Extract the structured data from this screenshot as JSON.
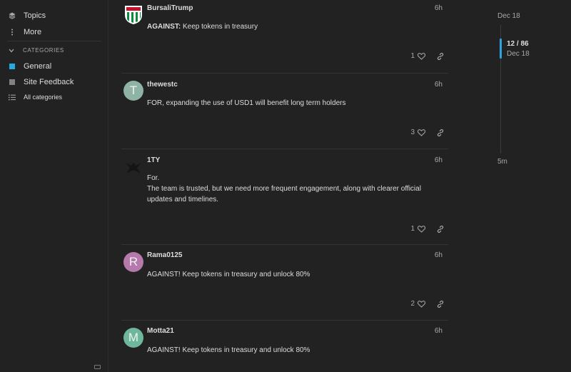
{
  "sidebar": {
    "items": [
      {
        "label": "Topics",
        "icon": "layers-icon"
      },
      {
        "label": "More",
        "icon": "vertical-ellipsis-icon"
      }
    ],
    "categories_header": "CATEGORIES",
    "categories": [
      {
        "label": "General",
        "color": "#25aae1"
      },
      {
        "label": "Site Feedback",
        "color": "#808281"
      },
      {
        "label": "All categories",
        "icon": "list-icon"
      }
    ]
  },
  "posts": [
    {
      "username": "BursaliTrump",
      "time": "6h",
      "bold_prefix": "AGAINST:",
      "text": " Keep tokens in treasury",
      "likes": "1",
      "avatar_letter": ""
    },
    {
      "username": "thewestc",
      "time": "6h",
      "text": "FOR, expanding the use of USD1 will benefit long term holders",
      "likes": "3",
      "avatar_letter": "T",
      "avatar_color": "#8fb3a4"
    },
    {
      "username": "1TY",
      "time": "6h",
      "lines": [
        "For.",
        "The team is trusted, but we need more frequent engagement, along with clearer official updates and timelines."
      ],
      "likes": "1",
      "avatar_letter": ""
    },
    {
      "username": "Rama0125",
      "time": "6h",
      "text": "AGAINST! Keep tokens in treasury and unlock 80%",
      "likes": "2",
      "avatar_letter": "R",
      "avatar_color": "#b57aab"
    },
    {
      "username": "Motta21",
      "time": "6h",
      "text": "AGAINST! Keep tokens in treasury and unlock 80%",
      "likes": "",
      "avatar_letter": "M",
      "avatar_color": "#6fb79c"
    }
  ],
  "timeline": {
    "top_date": "Dec 18",
    "position": "12 / 86",
    "position_date": "Dec 18",
    "bottom_label": "5m",
    "accent": "#2fa2e0"
  }
}
